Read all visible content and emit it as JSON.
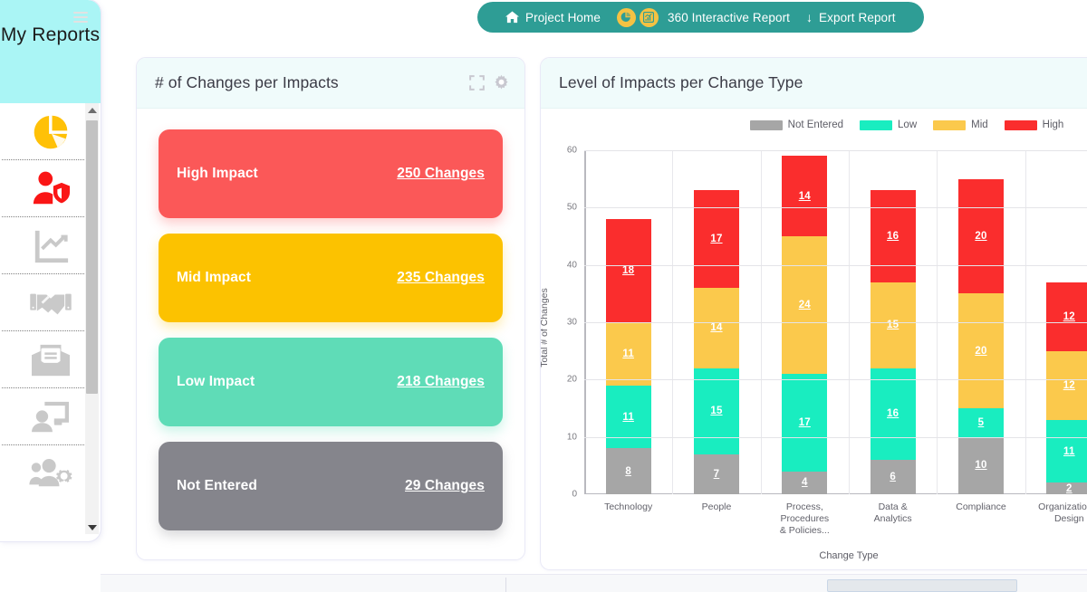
{
  "topnav": {
    "items": [
      {
        "label": "Project Home",
        "icon": "home-icon"
      },
      {
        "label": "360 Interactive Report",
        "icon": "pie-chart-icon"
      },
      {
        "label": "Export Report",
        "icon": "download-arrow-icon"
      }
    ],
    "bar_color": "#2e9d95",
    "badge_color": "#f5c243"
  },
  "sidebar": {
    "title": "My Reports",
    "header_color": "#aaf5f5",
    "menu_icon": "hamburger-icon",
    "items": [
      {
        "icon": "pie-chart-icon",
        "color": "#ffc107"
      },
      {
        "icon": "user-shield-icon",
        "color": "#fa1616"
      },
      {
        "icon": "line-chart-icon",
        "color": "#c9c9c9"
      },
      {
        "icon": "handshake-icon",
        "color": "#c9c9c9"
      },
      {
        "icon": "envelope-document-icon",
        "color": "#c9c9c9"
      },
      {
        "icon": "presentation-user-icon",
        "color": "#c9c9c9"
      },
      {
        "icon": "people-gear-icon",
        "color": "#c9c9c9"
      }
    ],
    "scrollbar": {
      "up": "scroll-up-arrow",
      "down": "scroll-down-arrow"
    }
  },
  "impacts_card": {
    "title": "# of Changes per Impacts",
    "header_icons": [
      "expand-icon",
      "gear-icon"
    ],
    "rows": [
      {
        "label": "High Impact",
        "value": "250 Changes",
        "color": "#fb5858"
      },
      {
        "label": "Mid Impact",
        "value": "235 Changes",
        "color": "#fcc200"
      },
      {
        "label": "Low Impact",
        "value": "218 Changes",
        "color": "#5fdcb7"
      },
      {
        "label": "Not Entered",
        "value": "29 Changes",
        "color": "#85858c"
      }
    ]
  },
  "levels_card": {
    "title": "Level of Impacts per Change Type"
  },
  "chart_data": {
    "type": "bar",
    "stacked": true,
    "title": "Level of Impacts per Change Type",
    "xlabel": "Change Type",
    "ylabel": "Total # of Changes",
    "ylim": [
      0,
      60
    ],
    "yticks": [
      0,
      10,
      20,
      30,
      40,
      50,
      60
    ],
    "grid": true,
    "legend_position": "top-center",
    "categories": [
      "Technology",
      "People",
      "Process, Procedures & Policies...",
      "Data & Analytics",
      "Compliance",
      "Organization... Design"
    ],
    "category_lines": [
      [
        "Technology"
      ],
      [
        "People"
      ],
      [
        "Process,",
        "Procedures",
        "& Policies..."
      ],
      [
        "Data &",
        "Analytics"
      ],
      [
        "Compliance"
      ],
      [
        "Organization...",
        "Design"
      ]
    ],
    "series": [
      {
        "name": "Not Entered",
        "color": "#a6a6a6",
        "values": [
          8,
          7,
          4,
          6,
          10,
          2
        ]
      },
      {
        "name": "Low",
        "color": "#19edc0",
        "values": [
          11,
          15,
          17,
          16,
          5,
          11
        ]
      },
      {
        "name": "Mid",
        "color": "#fbc94c",
        "values": [
          11,
          14,
          24,
          15,
          20,
          12
        ]
      },
      {
        "name": "High",
        "color": "#fa2d2d",
        "values": [
          18,
          17,
          14,
          16,
          20,
          12
        ]
      }
    ],
    "totals": [
      48,
      53,
      59,
      53,
      55,
      37
    ]
  }
}
